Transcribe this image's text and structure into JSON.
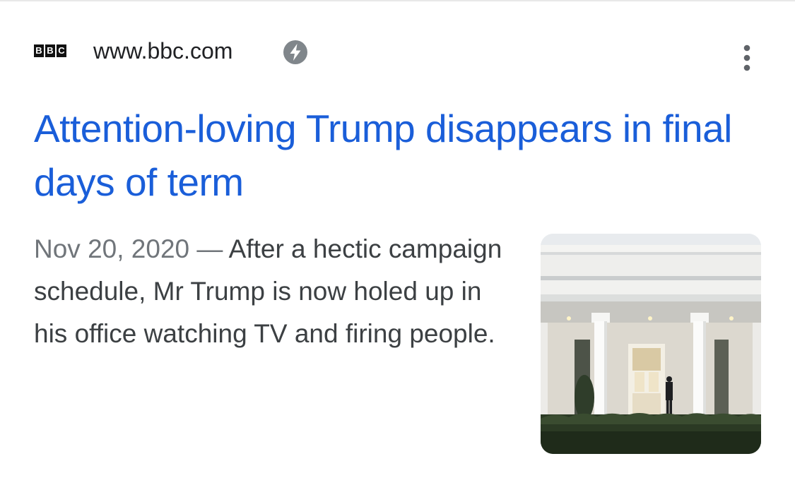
{
  "result": {
    "favicon_text": "BBC",
    "domain": "www.bbc.com",
    "amp_icon": "amp-lightning-icon",
    "menu_icon": "more-vert-icon",
    "headline": "Attention-loving Trump disappears in final days of term",
    "date": "Nov 20, 2020",
    "separator": "—",
    "snippet": "After a hectic campaign schedule, Mr Trump is now holed up in his office watching TV and firing people.",
    "thumbnail_icon": "white-house-photo"
  },
  "colors": {
    "headline": "#1a5ed9",
    "body_text": "#3c4043",
    "date_text": "#70757a",
    "amp_badge": "#80868b"
  }
}
